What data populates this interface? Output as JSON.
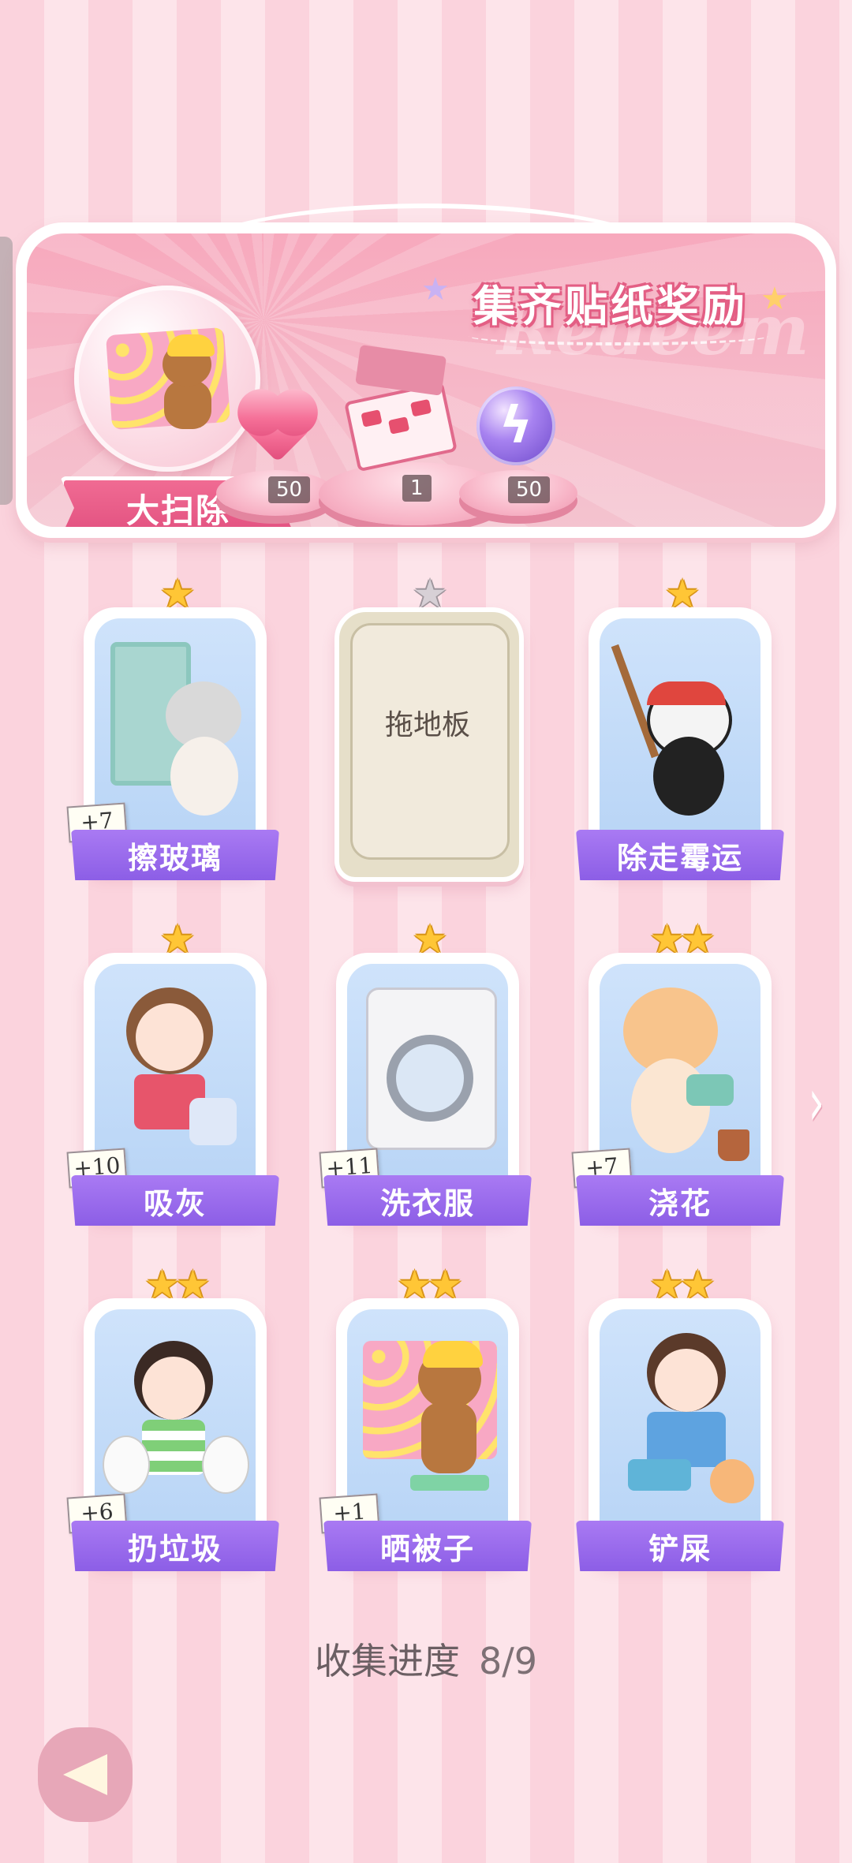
{
  "banner": {
    "title": "集齐贴纸奖励",
    "ghost_text": "Redeem",
    "current_sticker_label": "大扫除",
    "rewards": [
      {
        "icon": "heart-gem-icon",
        "count": "50"
      },
      {
        "icon": "gift-box-icon",
        "count": "1"
      },
      {
        "icon": "energy-orb-icon",
        "count": "50"
      }
    ]
  },
  "cards": [
    {
      "label": "擦玻璃",
      "stars": 1,
      "tag": "+7",
      "locked": false
    },
    {
      "label": "拖地板",
      "stars": 1,
      "tag": "",
      "locked": true
    },
    {
      "label": "除走霉运",
      "stars": 1,
      "tag": "",
      "locked": false
    },
    {
      "label": "吸灰",
      "stars": 1,
      "tag": "+10",
      "locked": false
    },
    {
      "label": "洗衣服",
      "stars": 1,
      "tag": "+11",
      "locked": false
    },
    {
      "label": "浇花",
      "stars": 2,
      "tag": "+7",
      "locked": false
    },
    {
      "label": "扔垃圾",
      "stars": 2,
      "tag": "+6",
      "locked": false
    },
    {
      "label": "晒被子",
      "stars": 2,
      "tag": "+1",
      "locked": false
    },
    {
      "label": "铲屎",
      "stars": 2,
      "tag": "",
      "locked": false
    }
  ],
  "progress": {
    "label": "收集进度",
    "value": "8/9"
  },
  "colors": {
    "card_banner": "#9a6aed",
    "star_gold": "#ffc636",
    "banner_pink": "#f7a9bd"
  }
}
